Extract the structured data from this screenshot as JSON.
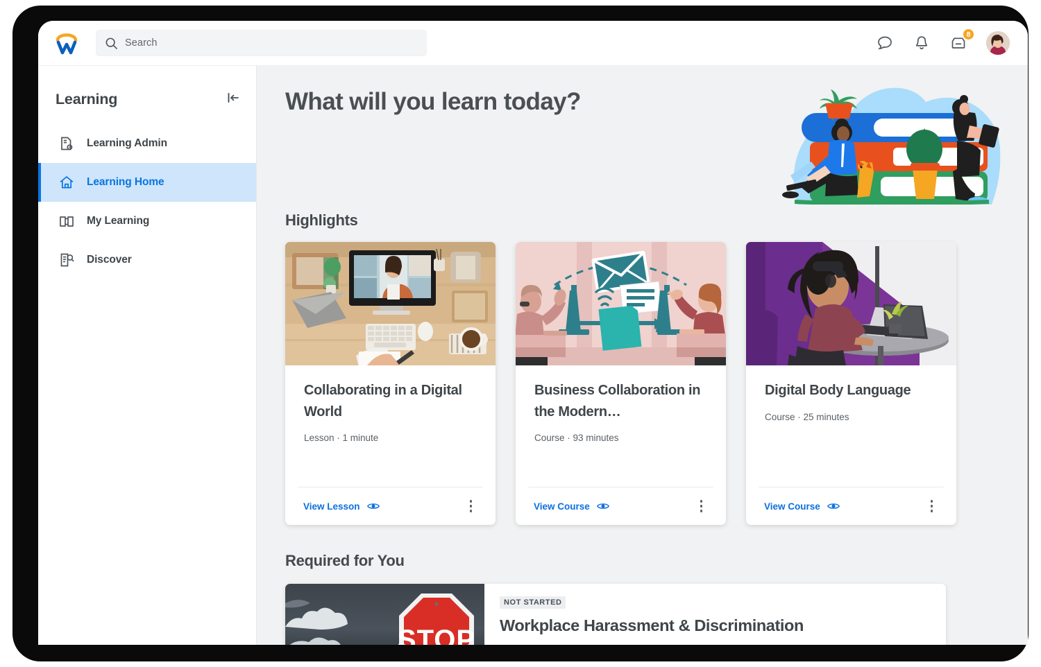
{
  "brand": {
    "logo_name": "workday-logo",
    "accent_orange": "#f5a623",
    "accent_blue": "#0875e1",
    "logo_blue": "#0b5fbd"
  },
  "topbar": {
    "search": {
      "placeholder": "Search",
      "value": "",
      "icon": "search-icon"
    },
    "icons": [
      {
        "name": "chat-icon"
      },
      {
        "name": "notifications-bell-icon"
      },
      {
        "name": "inbox-icon",
        "badge": "8"
      }
    ],
    "avatar_label": "User avatar"
  },
  "sidebar": {
    "title": "Learning",
    "collapse_icon": "collapse-panel-icon",
    "items": [
      {
        "label": "Learning Admin",
        "icon": "document-gear-icon",
        "active": false
      },
      {
        "label": "Learning Home",
        "icon": "home-icon",
        "active": true
      },
      {
        "label": "My Learning",
        "icon": "open-book-icon",
        "active": false
      },
      {
        "label": "Discover",
        "icon": "document-search-icon",
        "active": false
      }
    ]
  },
  "main": {
    "hero_title": "What will you learn today?",
    "highlights_title": "Highlights",
    "required_title": "Required for You",
    "cards": [
      {
        "title": "Collaborating in a Digital World",
        "meta": "Lesson · 1 minute",
        "action": "View Lesson",
        "action_icon": "eye-icon",
        "menu_icon": "more-options-icon",
        "image_alt": "overhead-desk-video-call-photo"
      },
      {
        "title": "Business Collaboration in the Modern…",
        "meta": "Course · 93 minutes",
        "action": "View Course",
        "action_icon": "eye-icon",
        "menu_icon": "more-options-icon",
        "image_alt": "office-collaboration-illustration"
      },
      {
        "title": "Digital Body Language",
        "meta": "Course · 25 minutes",
        "action": "View Course",
        "action_icon": "eye-icon",
        "menu_icon": "more-options-icon",
        "image_alt": "woman-with-headphones-laptop-photo"
      }
    ],
    "required": {
      "badge": "NOT STARTED",
      "title": "Workplace Harassment & Discrimination",
      "image_alt": "stop-sign-stormy-sky-photo"
    }
  }
}
